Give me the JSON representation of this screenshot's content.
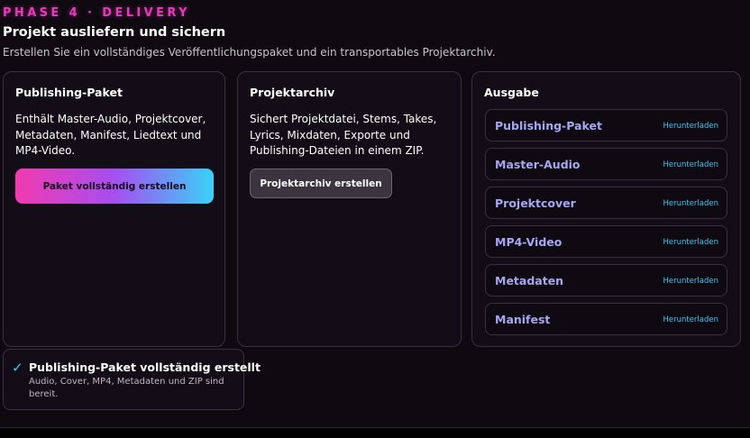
{
  "header": {
    "phase": "PHASE 4 · DELIVERY",
    "title": "Projekt ausliefern und sichern",
    "subtitle": "Erstellen Sie ein vollständiges Veröffentlichungspaket und ein transportables Projektarchiv."
  },
  "publishing_card": {
    "title": "Publishing-Paket",
    "description": "Enthält Master-Audio, Projektcover, Metadaten, Manifest, Liedtext und MP4-Video.",
    "button_label": "Paket vollständig erstellen"
  },
  "archive_card": {
    "title": "Projektarchiv",
    "description": "Sichert Projektdatei, Stems, Takes, Lyrics, Mixdaten, Exporte und Publishing-Dateien in einem ZIP.",
    "button_label": "Projektarchiv erstellen"
  },
  "output_card": {
    "title": "Ausgabe",
    "download_label": "Herunterladen",
    "items": [
      {
        "label": "Publishing-Paket"
      },
      {
        "label": "Master-Audio"
      },
      {
        "label": "Projektcover"
      },
      {
        "label": "MP4-Video"
      },
      {
        "label": "Metadaten"
      },
      {
        "label": "Manifest"
      }
    ]
  },
  "toast": {
    "icon": "checkmark-icon",
    "title": "Publishing-Paket vollständig erstellt",
    "text": "Audio, Cover, MP4, Metadaten und ZIP sind bereit."
  },
  "colors": {
    "accent_pink": "#e53bb8",
    "accent_cyan": "#3fc7ef",
    "output_label": "#a6a6f2",
    "background": "#0e0a10"
  }
}
